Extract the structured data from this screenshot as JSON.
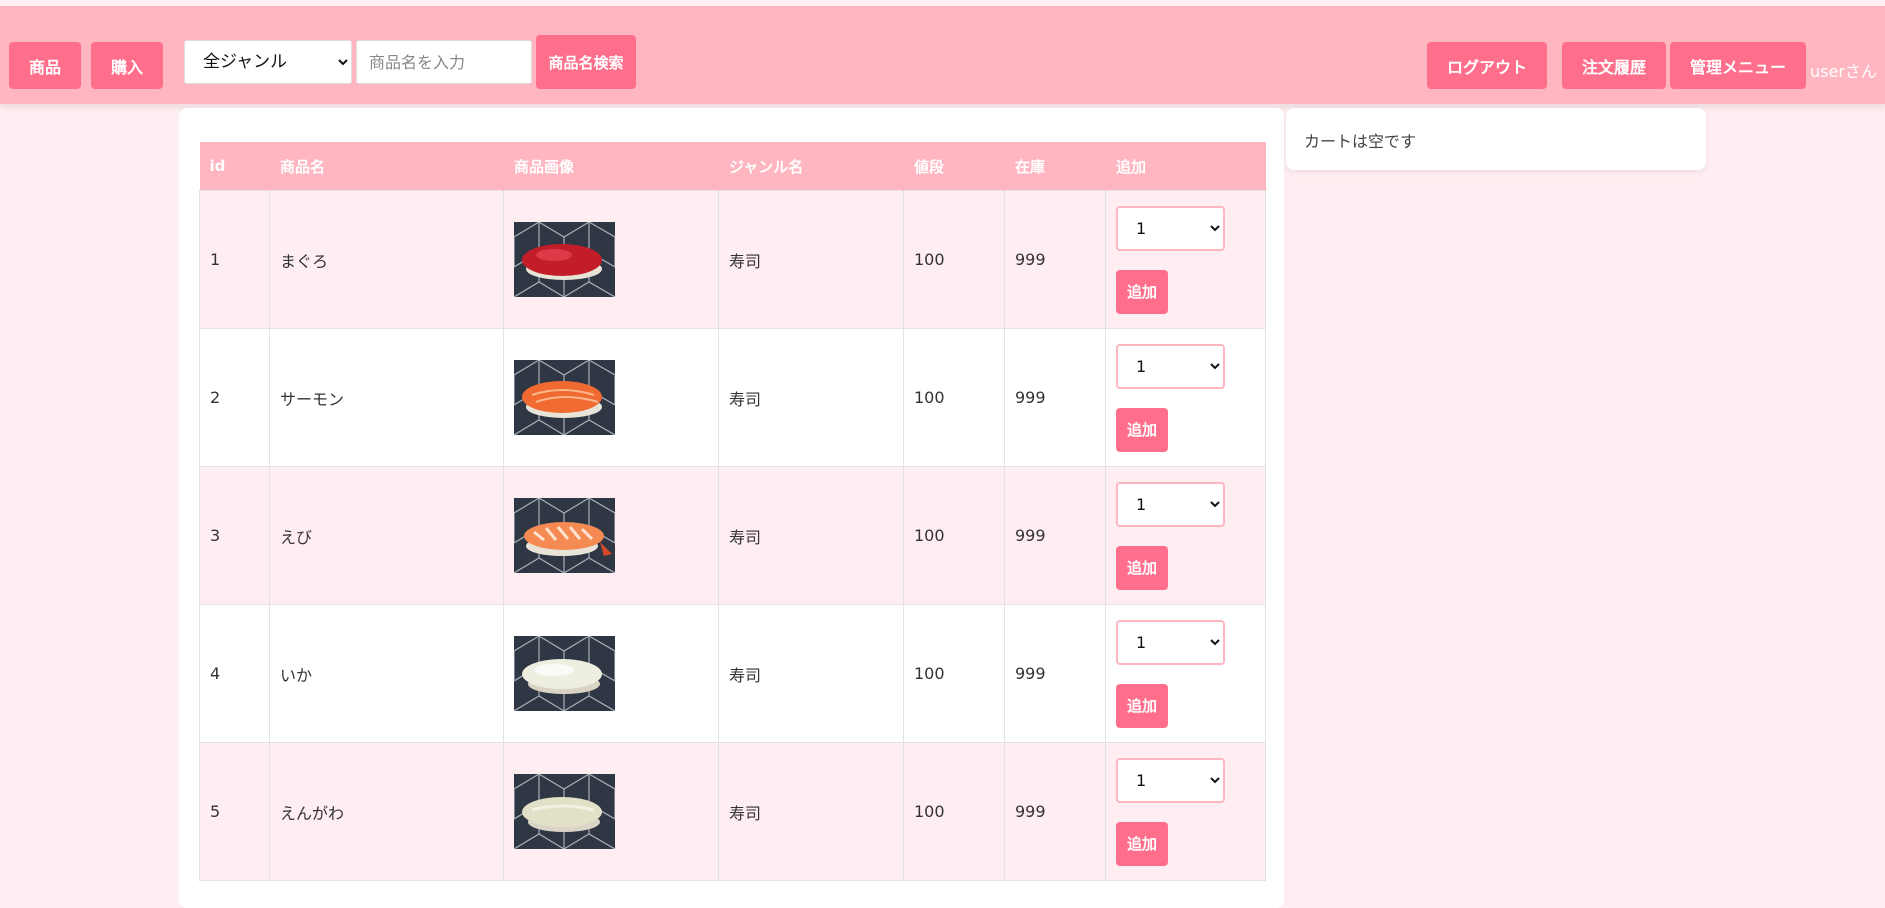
{
  "nav": {
    "products_label": "商品",
    "purchase_label": "購入",
    "genre_selected": "全ジャンル",
    "search_placeholder": "商品名を入力",
    "search_label": "商品名検索",
    "logout_label": "ログアウト",
    "history_label": "注文履歴",
    "admin_label": "管理メニュー",
    "username": "userさん"
  },
  "cart": {
    "empty_text": "カートは空です"
  },
  "table": {
    "headers": [
      "id",
      "商品名",
      "商品画像",
      "ジャンル名",
      "値段",
      "在庫",
      "追加"
    ],
    "add_label": "追加",
    "rows": [
      {
        "id": "1",
        "name": "まぐろ",
        "genre": "寿司",
        "price": "100",
        "stock": "999",
        "qty": "1",
        "image": "tuna-sushi"
      },
      {
        "id": "2",
        "name": "サーモン",
        "genre": "寿司",
        "price": "100",
        "stock": "999",
        "qty": "1",
        "image": "salmon-sushi"
      },
      {
        "id": "3",
        "name": "えび",
        "genre": "寿司",
        "price": "100",
        "stock": "999",
        "qty": "1",
        "image": "shrimp-sushi"
      },
      {
        "id": "4",
        "name": "いか",
        "genre": "寿司",
        "price": "100",
        "stock": "999",
        "qty": "1",
        "image": "squid-sushi"
      },
      {
        "id": "5",
        "name": "えんがわ",
        "genre": "寿司",
        "price": "100",
        "stock": "999",
        "qty": "1",
        "image": "engawa-sushi"
      }
    ]
  }
}
